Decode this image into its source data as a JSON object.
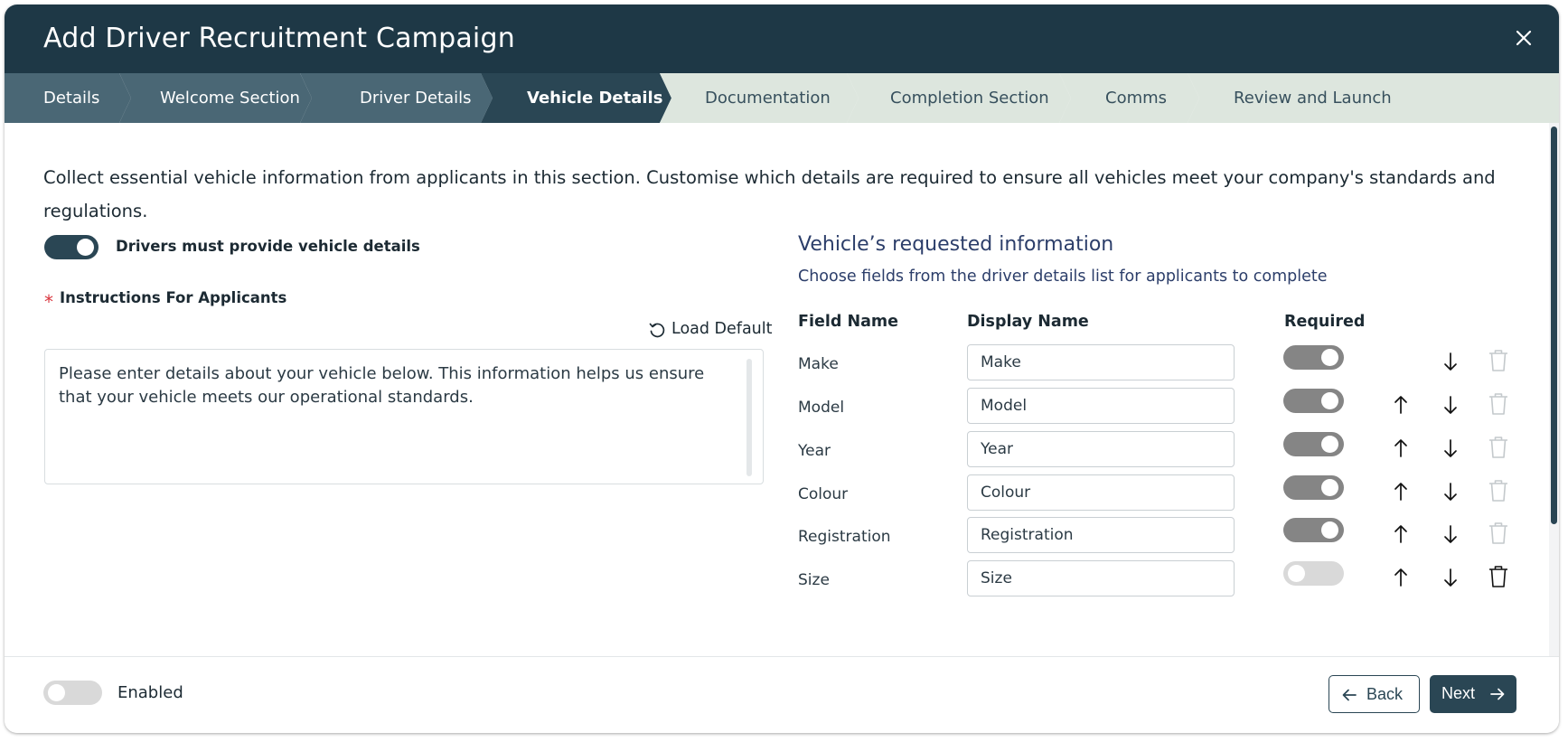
{
  "modal": {
    "title": "Add Driver Recruitment Campaign",
    "close_icon": "close-icon"
  },
  "stepper": {
    "steps": [
      {
        "label": "Details",
        "state": "completed"
      },
      {
        "label": "Welcome Section",
        "state": "completed"
      },
      {
        "label": "Driver Details",
        "state": "completed"
      },
      {
        "label": "Vehicle Details",
        "state": "active"
      },
      {
        "label": "Documentation",
        "state": "upcoming"
      },
      {
        "label": "Completion Section",
        "state": "upcoming"
      },
      {
        "label": "Comms",
        "state": "upcoming"
      },
      {
        "label": "Review and Launch",
        "state": "upcoming"
      }
    ]
  },
  "intro": {
    "text": "Collect essential vehicle information from applicants in this section. Customise which details are required to ensure all vehicles meet your company's standards and regulations."
  },
  "vehicle_toggle": {
    "label": "Drivers must provide vehicle details",
    "on": true
  },
  "instructions": {
    "required_mark": "*",
    "label": "Instructions For Applicants",
    "load_default_label": "Load Default",
    "load_default_icon": "undo-icon",
    "value": "Please enter details about your vehicle below. This information helps us ensure that your vehicle meets our operational standards."
  },
  "requested_info": {
    "title": "Vehicle’s requested information",
    "subtitle": "Choose fields from the driver details list for applicants to complete",
    "columns": {
      "field_name": "Field Name",
      "display_name": "Display Name",
      "required": "Required"
    },
    "fields": [
      {
        "field_name": "Make",
        "display_name": "Make",
        "required": true,
        "disabled": true,
        "can_move_up": false,
        "can_move_down": true,
        "can_delete": false
      },
      {
        "field_name": "Model",
        "display_name": "Model",
        "required": true,
        "disabled": true,
        "can_move_up": true,
        "can_move_down": true,
        "can_delete": false
      },
      {
        "field_name": "Year",
        "display_name": "Year",
        "required": true,
        "disabled": true,
        "can_move_up": true,
        "can_move_down": true,
        "can_delete": false
      },
      {
        "field_name": "Colour",
        "display_name": "Colour",
        "required": true,
        "disabled": true,
        "can_move_up": true,
        "can_move_down": true,
        "can_delete": false
      },
      {
        "field_name": "Registration",
        "display_name": "Registration",
        "required": true,
        "disabled": true,
        "can_move_up": true,
        "can_move_down": true,
        "can_delete": false
      },
      {
        "field_name": "Size",
        "display_name": "Size",
        "required": false,
        "disabled": true,
        "can_move_up": true,
        "can_move_down": true,
        "can_delete": true
      }
    ]
  },
  "footer": {
    "enabled_label": "Enabled",
    "enabled_on": false,
    "back_label": "Back",
    "back_icon": "arrow-left-icon",
    "next_label": "Next",
    "next_icon": "arrow-right-icon"
  },
  "colors": {
    "header_bg": "#1e3846",
    "step_completed_bg": "#4a6775",
    "step_active_bg": "#2a4654",
    "step_upcoming_bg": "#dde6de",
    "primary": "#2a4654",
    "toggle_disabled_on": "#858585",
    "toggle_off": "#d9d9d9"
  }
}
